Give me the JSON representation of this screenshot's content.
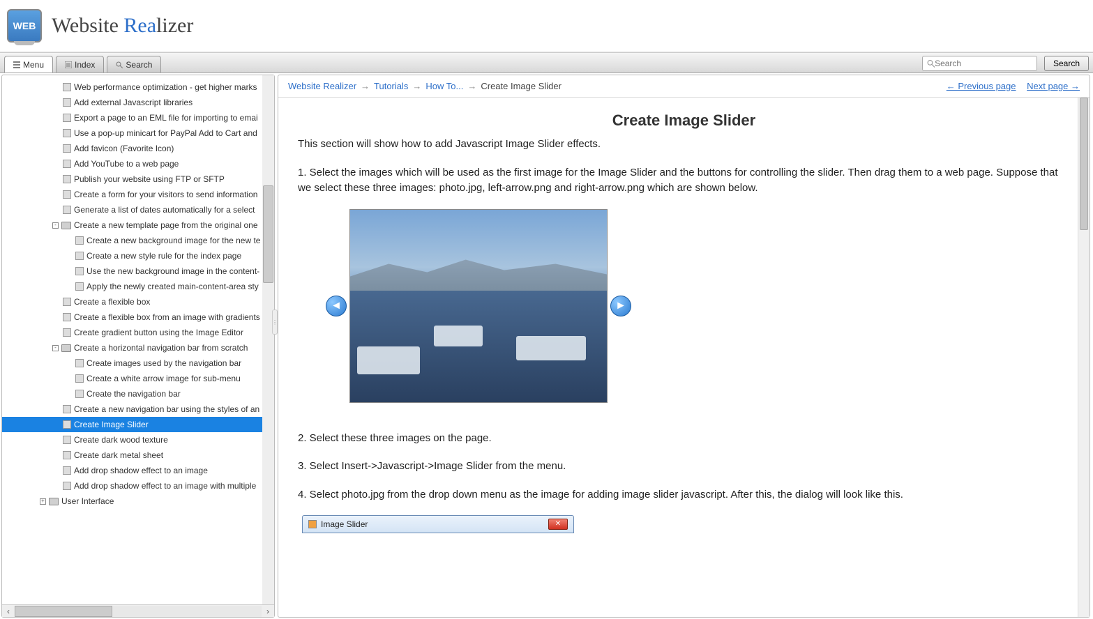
{
  "brand": {
    "part1": "Website ",
    "part2": "Rea",
    "part3": "lizer",
    "logo_text": "WEB"
  },
  "tabs": {
    "menu": "Menu",
    "index": "Index",
    "search": "Search"
  },
  "search": {
    "placeholder": "Search",
    "button": "Search"
  },
  "breadcrumb": {
    "root": "Website Realizer",
    "tutorials": "Tutorials",
    "howto": "How To...",
    "current": "Create Image Slider",
    "prev": "← Previous page",
    "next": "Next page →"
  },
  "article": {
    "title": "Create Image Slider",
    "intro": "This section will show how to add Javascript Image Slider effects.",
    "step1": "1. Select the images which will be used as the first image for the Image Slider and the buttons for controlling the slider. Then drag them to a web page. Suppose that we select these three images: photo.jpg, left-arrow.png and right-arrow.png which are shown below.",
    "step2": "2. Select these three images on the page.",
    "step3": "3. Select Insert->Javascript->Image Slider from the menu.",
    "step4": "4. Select photo.jpg from the drop down menu as the image for adding image slider javascript. After this, the dialog will look like this.",
    "dialog_title": "Image Slider"
  },
  "tree": [
    {
      "level": 3,
      "icon": "page",
      "label": "Web performance optimization - get higher marks"
    },
    {
      "level": 3,
      "icon": "page",
      "label": "Add external Javascript libraries"
    },
    {
      "level": 3,
      "icon": "page",
      "label": "Export a page to an EML file for importing to emai"
    },
    {
      "level": 3,
      "icon": "page",
      "label": "Use a pop-up minicart for PayPal Add to Cart and"
    },
    {
      "level": 3,
      "icon": "page",
      "label": "Add favicon (Favorite Icon)"
    },
    {
      "level": 3,
      "icon": "page",
      "label": "Add YouTube to a web page"
    },
    {
      "level": 3,
      "icon": "page",
      "label": "Publish your website using FTP or SFTP"
    },
    {
      "level": 3,
      "icon": "page",
      "label": "Create a form for your visitors to send information"
    },
    {
      "level": 3,
      "icon": "page",
      "label": "Generate a list of dates automatically for a select"
    },
    {
      "level": 3,
      "icon": "book",
      "label": "Create a new template page from the original one",
      "expander": "-"
    },
    {
      "level": 4,
      "icon": "page",
      "label": "Create a new background image for the new te"
    },
    {
      "level": 4,
      "icon": "page",
      "label": "Create a new style rule for the index page"
    },
    {
      "level": 4,
      "icon": "page",
      "label": "Use the new background image in the content-"
    },
    {
      "level": 4,
      "icon": "page",
      "label": "Apply the newly created main-content-area sty"
    },
    {
      "level": 3,
      "icon": "page",
      "label": "Create a flexible box"
    },
    {
      "level": 3,
      "icon": "page",
      "label": "Create a flexible box from an image with gradients"
    },
    {
      "level": 3,
      "icon": "page",
      "label": "Create gradient button using the Image Editor"
    },
    {
      "level": 3,
      "icon": "book",
      "label": "Create a horizontal navigation bar from scratch",
      "expander": "-"
    },
    {
      "level": 4,
      "icon": "page",
      "label": "Create images used by the navigation bar"
    },
    {
      "level": 4,
      "icon": "page",
      "label": "Create a white arrow image for sub-menu"
    },
    {
      "level": 4,
      "icon": "page",
      "label": "Create the navigation bar"
    },
    {
      "level": 3,
      "icon": "page",
      "label": "Create a new navigation bar using the styles of an"
    },
    {
      "level": 3,
      "icon": "page",
      "label": "Create Image Slider",
      "selected": true
    },
    {
      "level": 3,
      "icon": "page",
      "label": "Create dark wood texture"
    },
    {
      "level": 3,
      "icon": "page",
      "label": "Create dark metal sheet"
    },
    {
      "level": 3,
      "icon": "page",
      "label": "Add drop shadow effect to an image"
    },
    {
      "level": 3,
      "icon": "page",
      "label": "Add drop shadow effect to an image with multiple"
    },
    {
      "level": 2,
      "icon": "book",
      "label": "User Interface",
      "expander": "+"
    }
  ]
}
